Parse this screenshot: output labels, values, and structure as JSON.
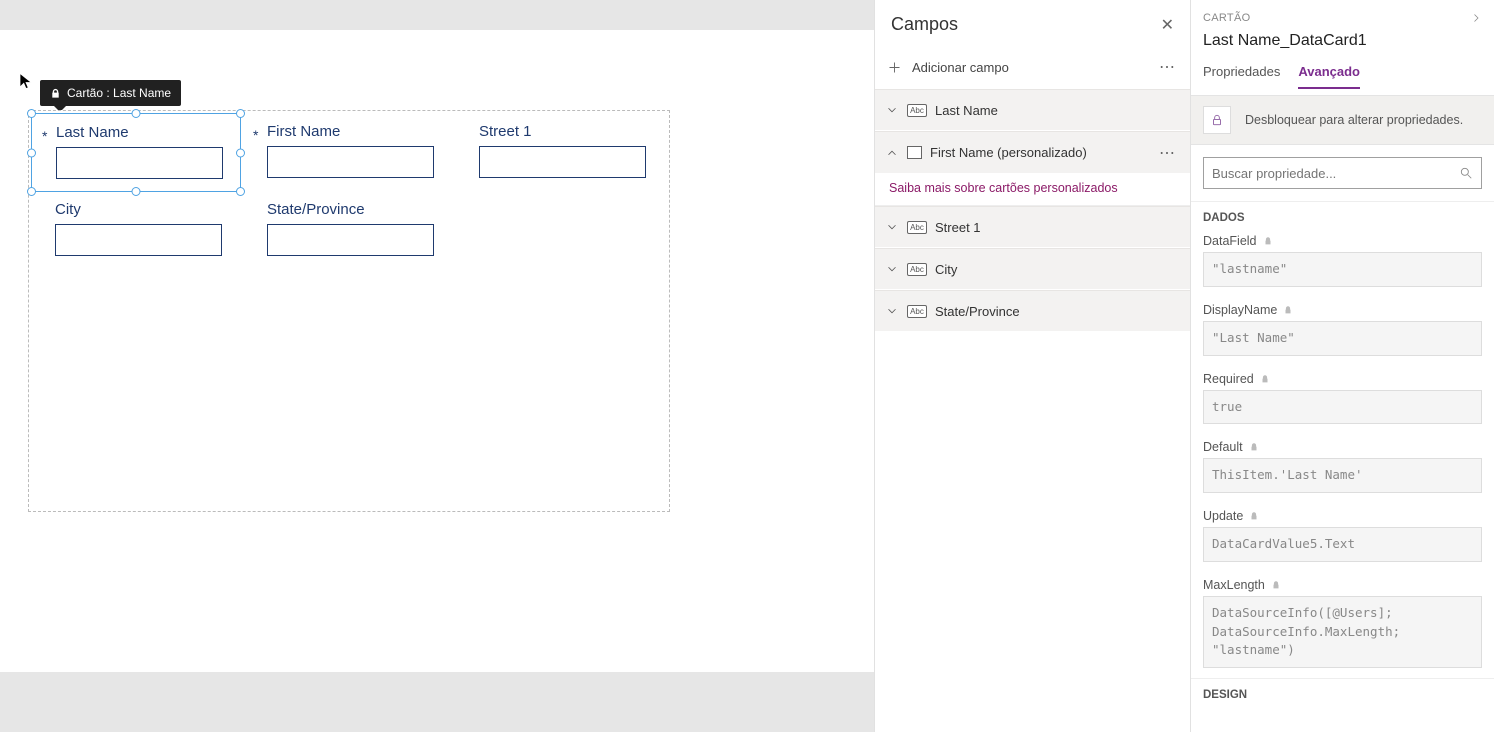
{
  "tooltip": {
    "text": "Cartão : Last Name"
  },
  "form": {
    "cards": [
      {
        "label": "Last Name",
        "required": true,
        "row": 0,
        "col": 0,
        "selected": true
      },
      {
        "label": "First Name",
        "required": true,
        "row": 0,
        "col": 1,
        "selected": false
      },
      {
        "label": "Street 1",
        "required": false,
        "row": 0,
        "col": 2,
        "selected": false
      },
      {
        "label": "City",
        "required": false,
        "row": 1,
        "col": 0,
        "selected": false
      },
      {
        "label": "State/Province",
        "required": false,
        "row": 1,
        "col": 1,
        "selected": false
      }
    ]
  },
  "fieldsPanel": {
    "title": "Campos",
    "addLabel": "Adicionar campo",
    "items": [
      {
        "name": "Last Name",
        "type": "abc",
        "expanded": false
      },
      {
        "name": "First Name (personalizado)",
        "type": "custom",
        "expanded": true,
        "menu": true
      },
      {
        "name": "Street 1",
        "type": "abc",
        "expanded": false
      },
      {
        "name": "City",
        "type": "abc",
        "expanded": false
      },
      {
        "name": "State/Province",
        "type": "abc",
        "expanded": false
      }
    ],
    "customLink": "Saiba mais sobre cartões personalizados"
  },
  "propsPanel": {
    "kicker": "CARTÃO",
    "title": "Last Name_DataCard1",
    "tabs": {
      "properties": "Propriedades",
      "advanced": "Avançado"
    },
    "lockText": "Desbloquear para alterar propriedades.",
    "searchPlaceholder": "Buscar propriedade...",
    "sections": {
      "dados": "DADOS",
      "design": "DESIGN"
    },
    "props": [
      {
        "label": "DataField",
        "value": "\"lastname\""
      },
      {
        "label": "DisplayName",
        "value": "\"Last Name\""
      },
      {
        "label": "Required",
        "value": "true"
      },
      {
        "label": "Default",
        "value": "ThisItem.'Last Name'"
      },
      {
        "label": "Update",
        "value": "DataCardValue5.Text"
      },
      {
        "label": "MaxLength",
        "value": "DataSourceInfo([@Users];\nDataSourceInfo.MaxLength;\n\"lastname\")"
      }
    ]
  },
  "icons": {
    "abc": "Abc"
  }
}
